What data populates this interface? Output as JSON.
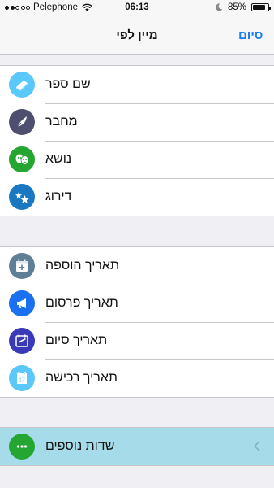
{
  "status_bar": {
    "carrier": "Pelephone",
    "time": "06:13",
    "battery": "85%",
    "battery_level": 0.85,
    "signal_dots_filled": 2,
    "signal_dots_total": 5
  },
  "nav": {
    "title": "מיין לפי",
    "done_label": "סיום"
  },
  "groups": [
    {
      "rows": [
        {
          "label": "שם ספר",
          "icon": "book-icon",
          "color": "#5ac8fa"
        },
        {
          "label": "מחבר",
          "icon": "feather-icon",
          "color": "#4e4e6e"
        },
        {
          "label": "נושא",
          "icon": "theater-masks-icon",
          "color": "#25a632"
        },
        {
          "label": "דירוג",
          "icon": "stars-icon",
          "color": "#1a78c2"
        }
      ]
    },
    {
      "rows": [
        {
          "label": "תאריך הוספה",
          "icon": "calendar-add-icon",
          "color": "#5e7f96"
        },
        {
          "label": "תאריך פרסום",
          "icon": "megaphone-icon",
          "color": "#1a70f0"
        },
        {
          "label": "תאריך סיום",
          "icon": "calendar-check-icon",
          "color": "#3a3ab8"
        },
        {
          "label": "תאריך רכישה",
          "icon": "calendar-17-icon",
          "color": "#5ac8fa",
          "day": "17"
        }
      ]
    },
    {
      "rows": [
        {
          "label": "שדות נוספים",
          "icon": "more-dots-icon",
          "color": "#25a632"
        }
      ]
    }
  ]
}
